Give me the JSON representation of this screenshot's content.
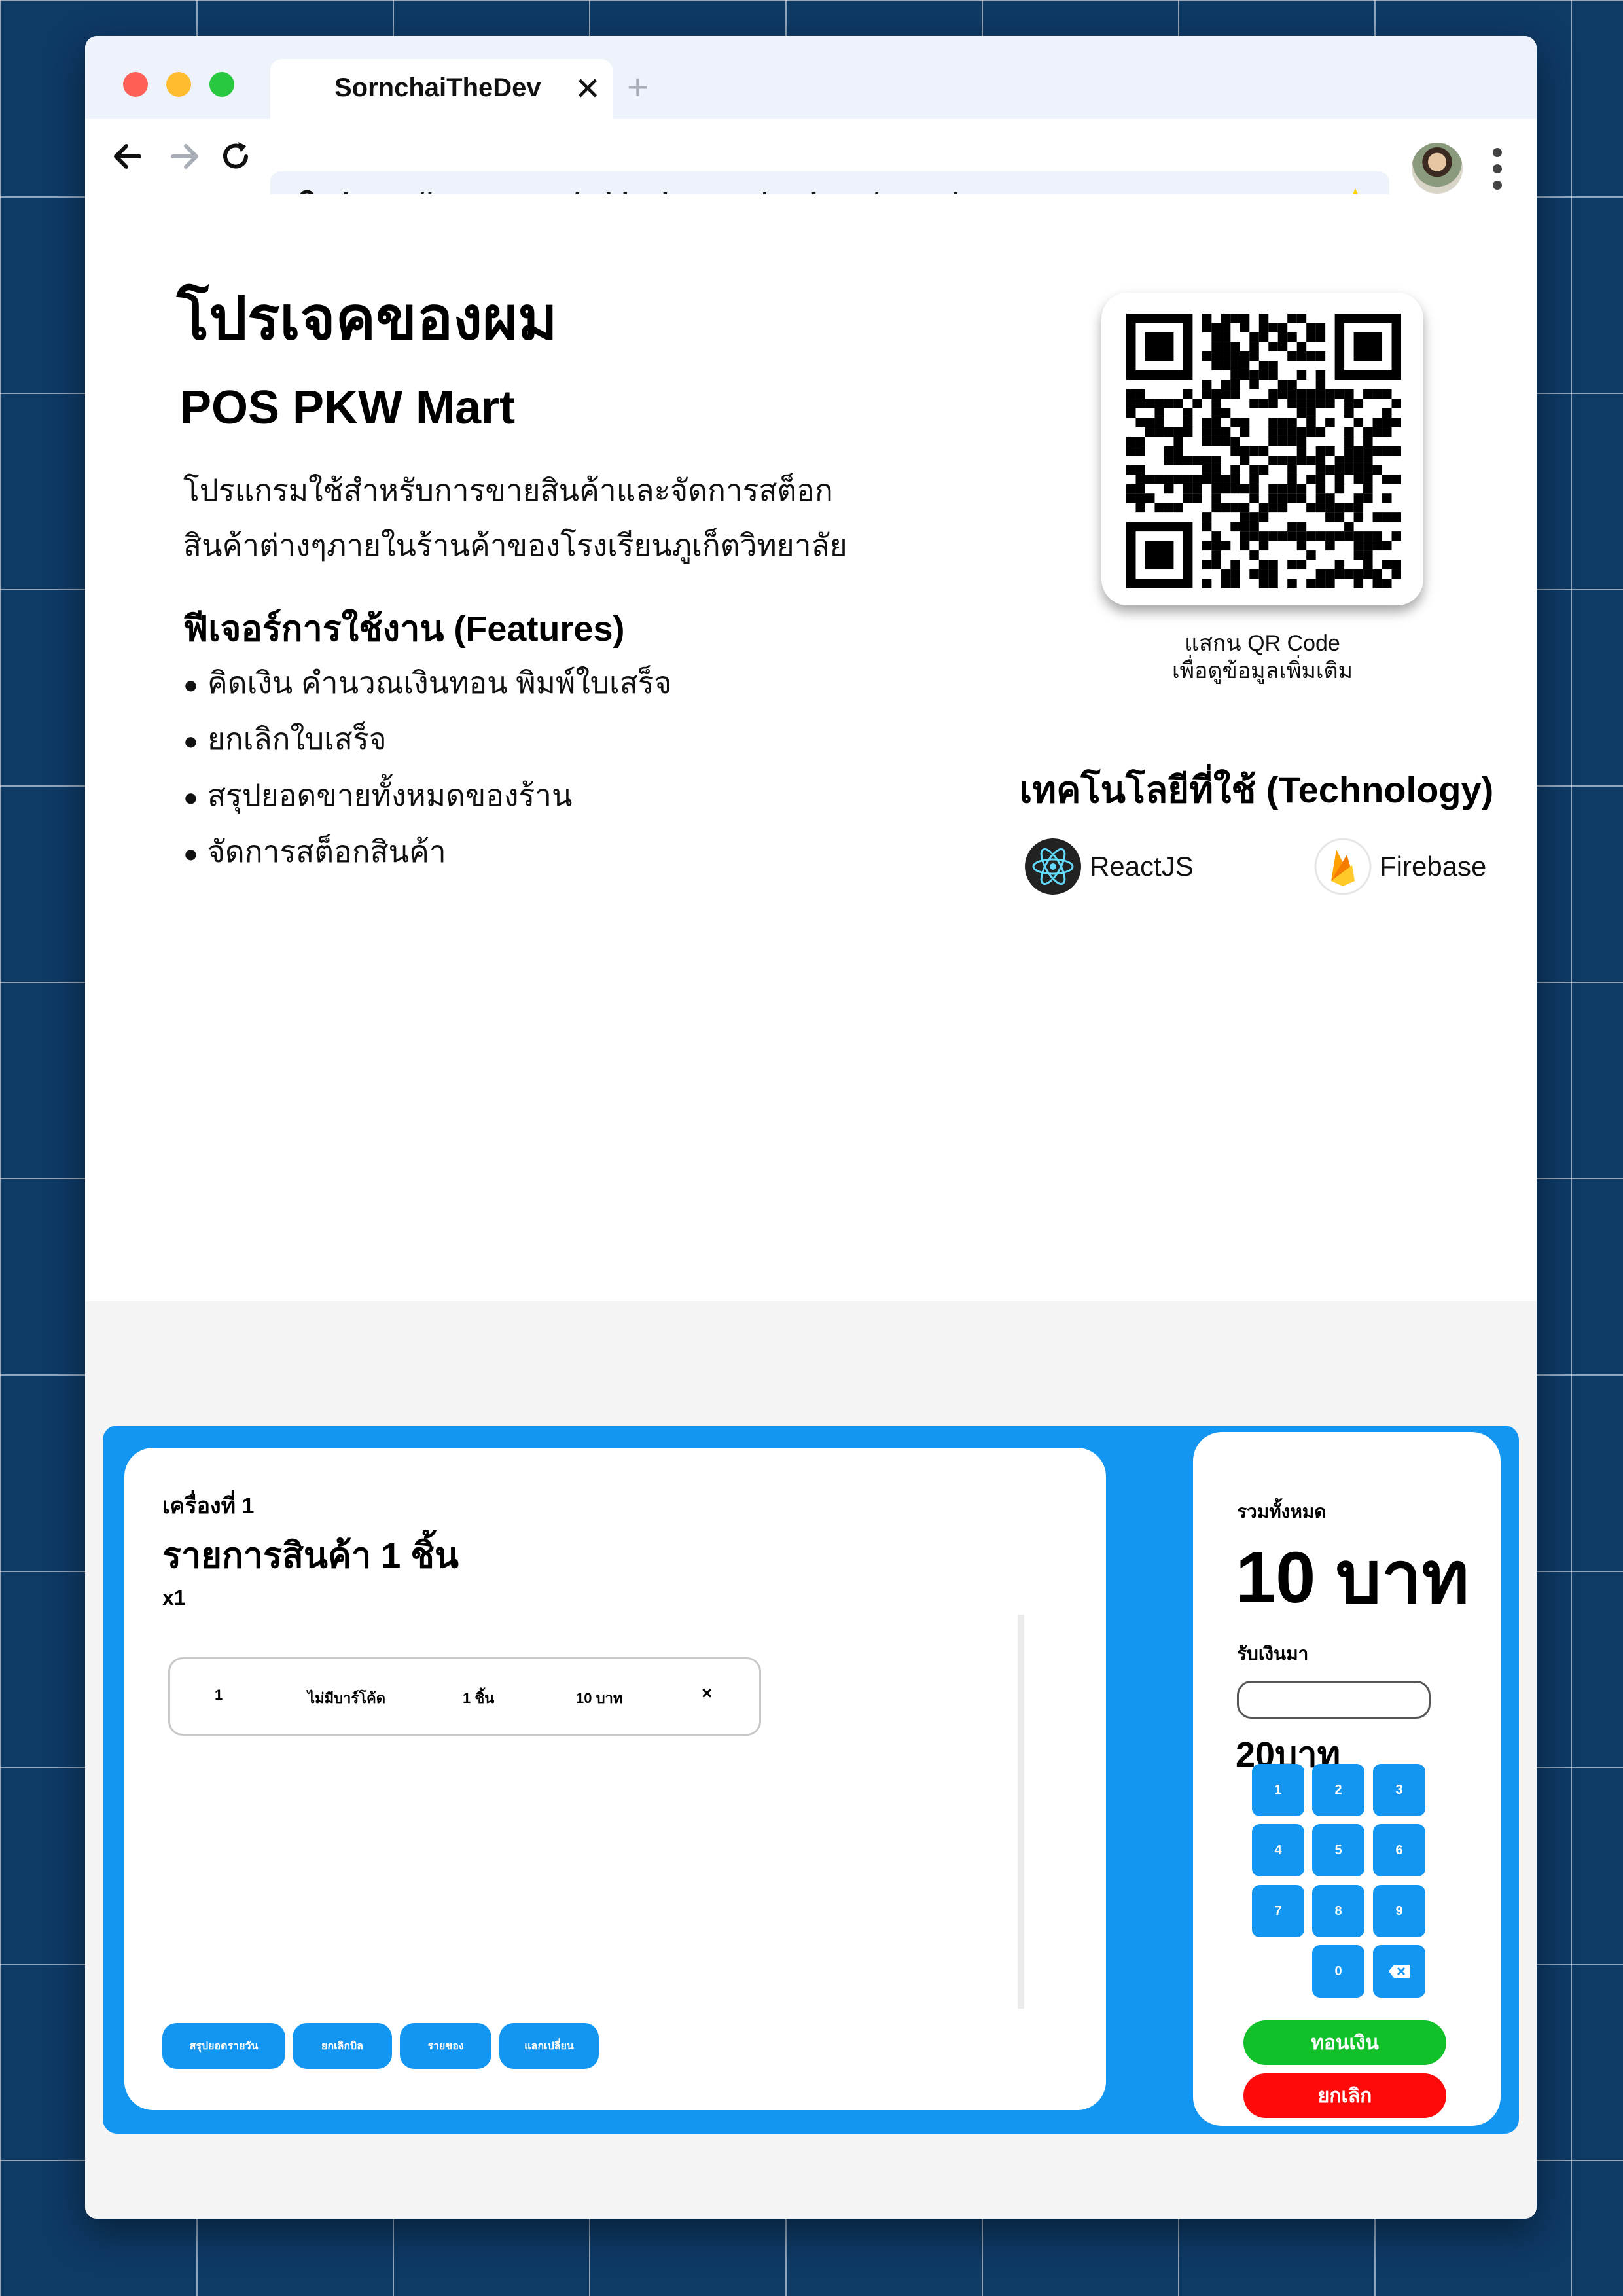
{
  "browser": {
    "tab_title": "SornchaiTheDev",
    "tab_close": "✕",
    "new_tab": "+",
    "url": "https://www.sornchaithedev.com/projects/pos-pkw-mart"
  },
  "page": {
    "heading": "โปรเจคของผม",
    "project_name": "POS PKW Mart",
    "description_line1": "โปรแกรมใช้สำหรับการขายสินค้าและจัดการสต็อก",
    "description_line2": "สินค้าต่างๆภายในร้านค้าของโรงเรียนภูเก็ตวิทยาลัย",
    "features_title": "ฟีเจอร์การใช้งาน (Features)",
    "features": [
      "คิดเงิน คำนวณเงินทอน พิมพ์ใบเสร็จ",
      "ยกเลิกใบเสร็จ",
      "สรุปยอดขายทั้งหมดของร้าน",
      "จัดการสต็อกสินค้า"
    ],
    "qr_caption_line1": "แสกน QR Code",
    "qr_caption_line2": "เพื่อดูข้อมูลเพิ่มเติม",
    "tech_title": "เทคโนโลยีที่ใช้ (Technology)",
    "tech": [
      {
        "label": "ReactJS",
        "icon": "react-icon"
      },
      {
        "label": "Firebase",
        "icon": "firebase-icon"
      }
    ]
  },
  "pos": {
    "machine": "เครื่องที่ 1",
    "items_title": "รายการสินค้า 1 ชิ้น",
    "qty": "x1",
    "row": {
      "index": "1",
      "barcode": "ไม่มีบาร์โค้ด",
      "amount": "1 ชิ้น",
      "price": "10 บาท",
      "remove": "×"
    },
    "buttons": [
      "สรุปยอดรายวัน",
      "ยกเลิกบิล",
      "รายของ",
      "แลกเปลี่ยน"
    ],
    "total_label": "รวมทั้งหมด",
    "total_value": "10 บาท",
    "received_label": "รับเงินมา",
    "received_value": "20บาท",
    "keys": [
      "1",
      "2",
      "3",
      "4",
      "5",
      "6",
      "7",
      "8",
      "9",
      "0"
    ],
    "change_button": "ทอนเงิน",
    "cancel_button": "ยกเลิก"
  },
  "colors": {
    "background": "#0e3a66",
    "accent": "#1296f2",
    "success": "#12c02a",
    "danger": "#ff0a0a"
  }
}
